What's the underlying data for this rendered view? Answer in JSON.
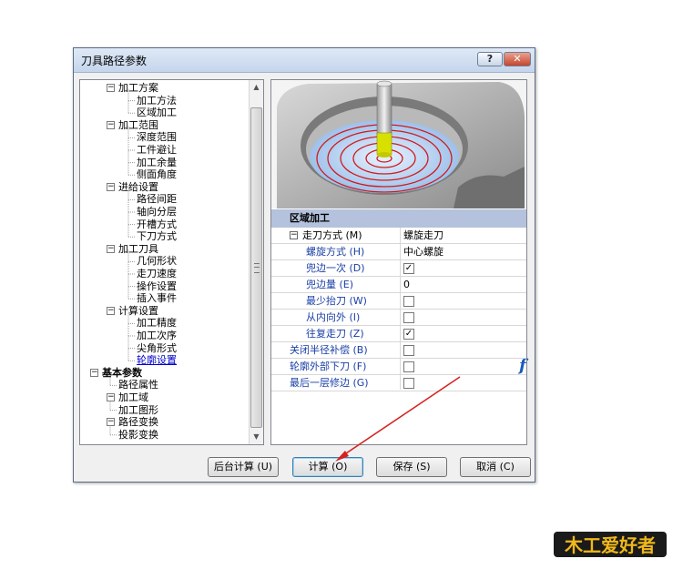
{
  "window": {
    "title": "刀具路径参数",
    "help_label": "?",
    "close_label": "✕"
  },
  "tree": {
    "items": [
      {
        "label": "加工方案",
        "indent": 0,
        "expander": "⊟"
      },
      {
        "label": "加工方法",
        "indent": 1
      },
      {
        "label": "区域加工",
        "indent": 1
      },
      {
        "label": "加工范围",
        "indent": 0,
        "expander": "⊟"
      },
      {
        "label": "深度范围",
        "indent": 1
      },
      {
        "label": "工件避让",
        "indent": 1
      },
      {
        "label": "加工余量",
        "indent": 1
      },
      {
        "label": "侧面角度",
        "indent": 1
      },
      {
        "label": "进给设置",
        "indent": 0,
        "expander": "⊟"
      },
      {
        "label": "路径间距",
        "indent": 1
      },
      {
        "label": "轴向分层",
        "indent": 1
      },
      {
        "label": "开槽方式",
        "indent": 1
      },
      {
        "label": "下刀方式",
        "indent": 1
      },
      {
        "label": "加工刀具",
        "indent": 0,
        "expander": "⊟"
      },
      {
        "label": "几何形状",
        "indent": 1
      },
      {
        "label": "走刀速度",
        "indent": 1
      },
      {
        "label": "操作设置",
        "indent": 1
      },
      {
        "label": "插入事件",
        "indent": 1
      },
      {
        "label": "计算设置",
        "indent": 0,
        "expander": "⊟"
      },
      {
        "label": "加工精度",
        "indent": 1
      },
      {
        "label": "加工次序",
        "indent": 1
      },
      {
        "label": "尖角形式",
        "indent": 1
      },
      {
        "label": "轮廓设置",
        "indent": 1,
        "selected": true
      },
      {
        "label": "基本参数",
        "indent": -2,
        "expander": "⊟",
        "bold": true
      },
      {
        "label": "路径属性",
        "indent": -1
      },
      {
        "label": "加工域",
        "indent": -1,
        "expander": "⊟"
      },
      {
        "label": "加工图形",
        "indent": 0
      },
      {
        "label": "路径变换",
        "indent": -1,
        "expander": "⊟"
      },
      {
        "label": "投影变换",
        "indent": 0
      }
    ]
  },
  "scrollbar": {
    "up": "▲",
    "down": "▼"
  },
  "properties": {
    "section": "区域加工",
    "collapse": "−",
    "rows": [
      {
        "name": "走刀方式 (M)",
        "value": "螺旋走刀",
        "dark": true,
        "indent": 34
      },
      {
        "name": "螺旋方式 (H)",
        "value": "中心螺旋",
        "indent": 38
      },
      {
        "name": "兜边一次 (D)",
        "checked": true,
        "indent": 38
      },
      {
        "name": "兜边量 (E)",
        "value": "0",
        "indent": 38
      },
      {
        "name": "最少抬刀 (W)",
        "checked": false,
        "indent": 38
      },
      {
        "name": "从内向外 (I)",
        "checked": false,
        "indent": 38
      },
      {
        "name": "往复走刀 (Z)",
        "checked": true,
        "indent": 38
      },
      {
        "name": "关闭半径补偿 (B)",
        "checked": false,
        "indent": 20
      },
      {
        "name": "轮廓外部下刀 (F)",
        "checked": false,
        "indent": 20
      },
      {
        "name": "最后一层修边 (G)",
        "checked": false,
        "indent": 20
      }
    ],
    "check_mark": "✓",
    "side_logo": "f"
  },
  "buttons": {
    "background": "后台计算 (U)",
    "compute": "计算 (O)",
    "save": "保存 (S)",
    "cancel": "取消 (C)"
  },
  "watermark": {
    "text": "木工爱好者"
  },
  "colors": {
    "accent": "#1a3fa6",
    "arrow": "#d62020",
    "section_bg": "#b4c2dd"
  }
}
